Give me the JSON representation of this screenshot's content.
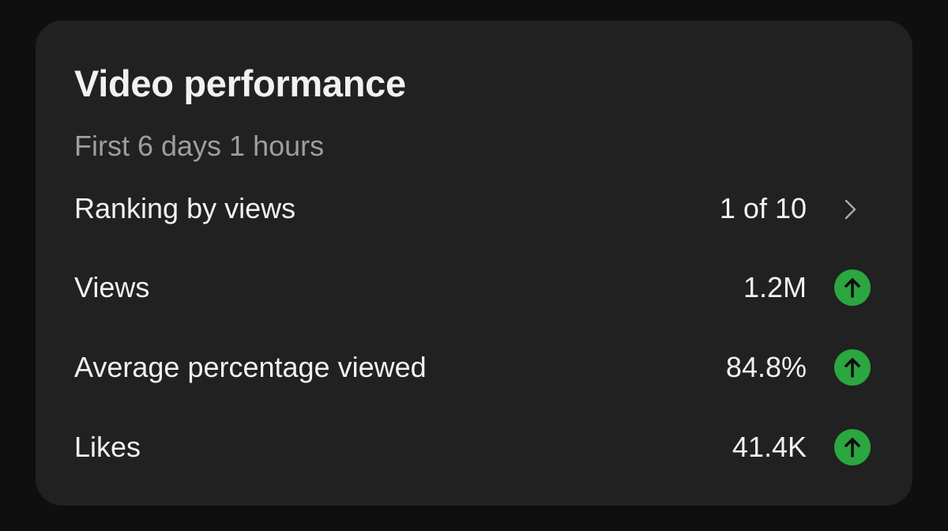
{
  "card": {
    "title": "Video performance",
    "subtitle": "First 6 days 1 hours"
  },
  "rows": [
    {
      "label": "Ranking by views",
      "value": "1 of 10",
      "indicator": "chevron-right-icon"
    },
    {
      "label": "Views",
      "value": "1.2M",
      "indicator": "trend-up-icon"
    },
    {
      "label": "Average percentage viewed",
      "value": "84.8%",
      "indicator": "trend-up-icon"
    },
    {
      "label": "Likes",
      "value": "41.4K",
      "indicator": "trend-up-icon"
    }
  ],
  "colors": {
    "page_background": "#0f0f0f",
    "card_background": "#212121",
    "primary_text": "#f1f1f1",
    "secondary_text": "#9e9e9e",
    "trend_up": "#2ba640"
  }
}
